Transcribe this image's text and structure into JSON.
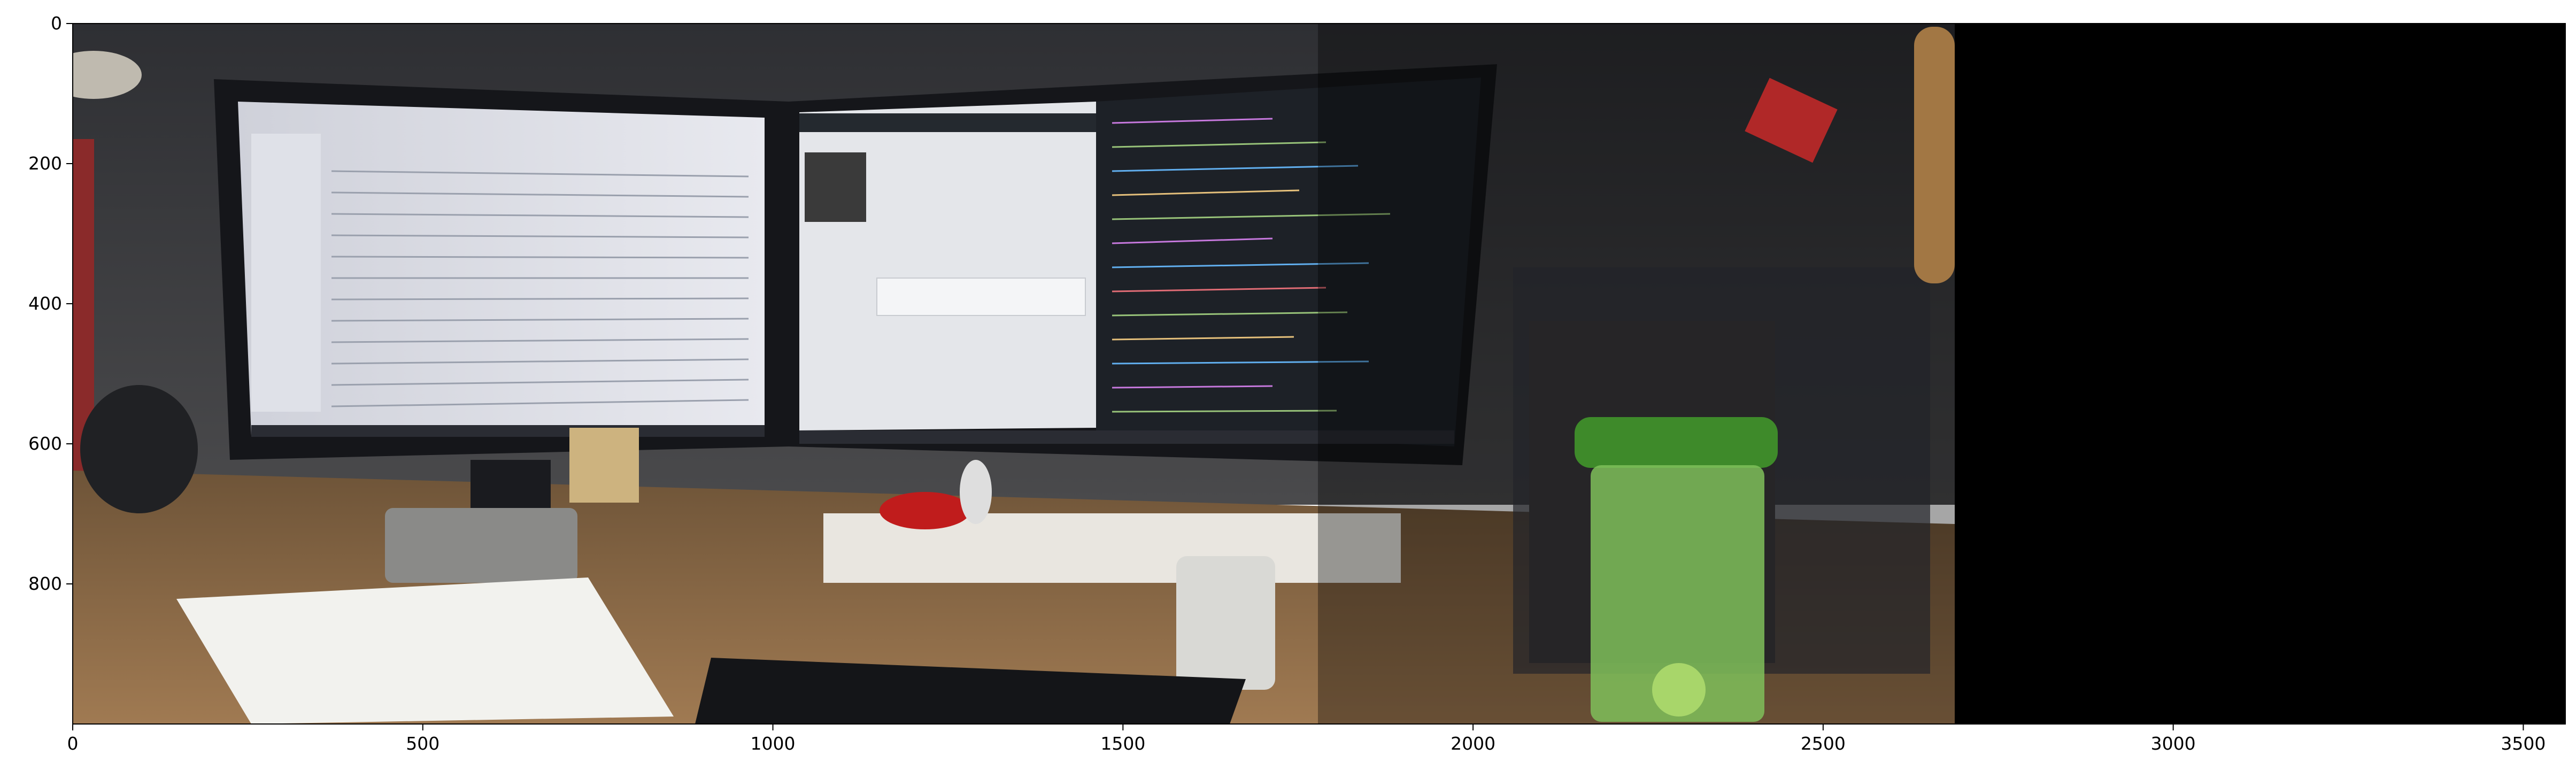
{
  "axes": {
    "x_ticks": [
      {
        "value": 0,
        "label": "0"
      },
      {
        "value": 500,
        "label": "500"
      },
      {
        "value": 1000,
        "label": "1000"
      },
      {
        "value": 1500,
        "label": "1500"
      },
      {
        "value": 2000,
        "label": "2000"
      },
      {
        "value": 2500,
        "label": "2500"
      },
      {
        "value": 3000,
        "label": "3000"
      },
      {
        "value": 3500,
        "label": "3500"
      }
    ],
    "y_ticks": [
      {
        "value": 0,
        "label": "0"
      },
      {
        "value": 200,
        "label": "200"
      },
      {
        "value": 400,
        "label": "400"
      },
      {
        "value": 600,
        "label": "600"
      },
      {
        "value": 800,
        "label": "800"
      }
    ],
    "x_range": [
      0,
      3560
    ],
    "y_range": [
      0,
      1000
    ]
  },
  "scene": {
    "description_tags": [
      "office-desk",
      "dual-monitor",
      "email-inbox-screen",
      "code-editor-screen",
      "books",
      "water-bottle",
      "keyboard",
      "mug",
      "cameras",
      "papers"
    ],
    "black_region_color": "#000000",
    "colors": {
      "monitor_bezel": "#15161a",
      "screen_light": "#e8e9ee",
      "screen_dark": "#1d2127",
      "desk": "#8a6a4a",
      "wall": "#3a3a3e",
      "bottle_green": "#5fae3c"
    }
  }
}
